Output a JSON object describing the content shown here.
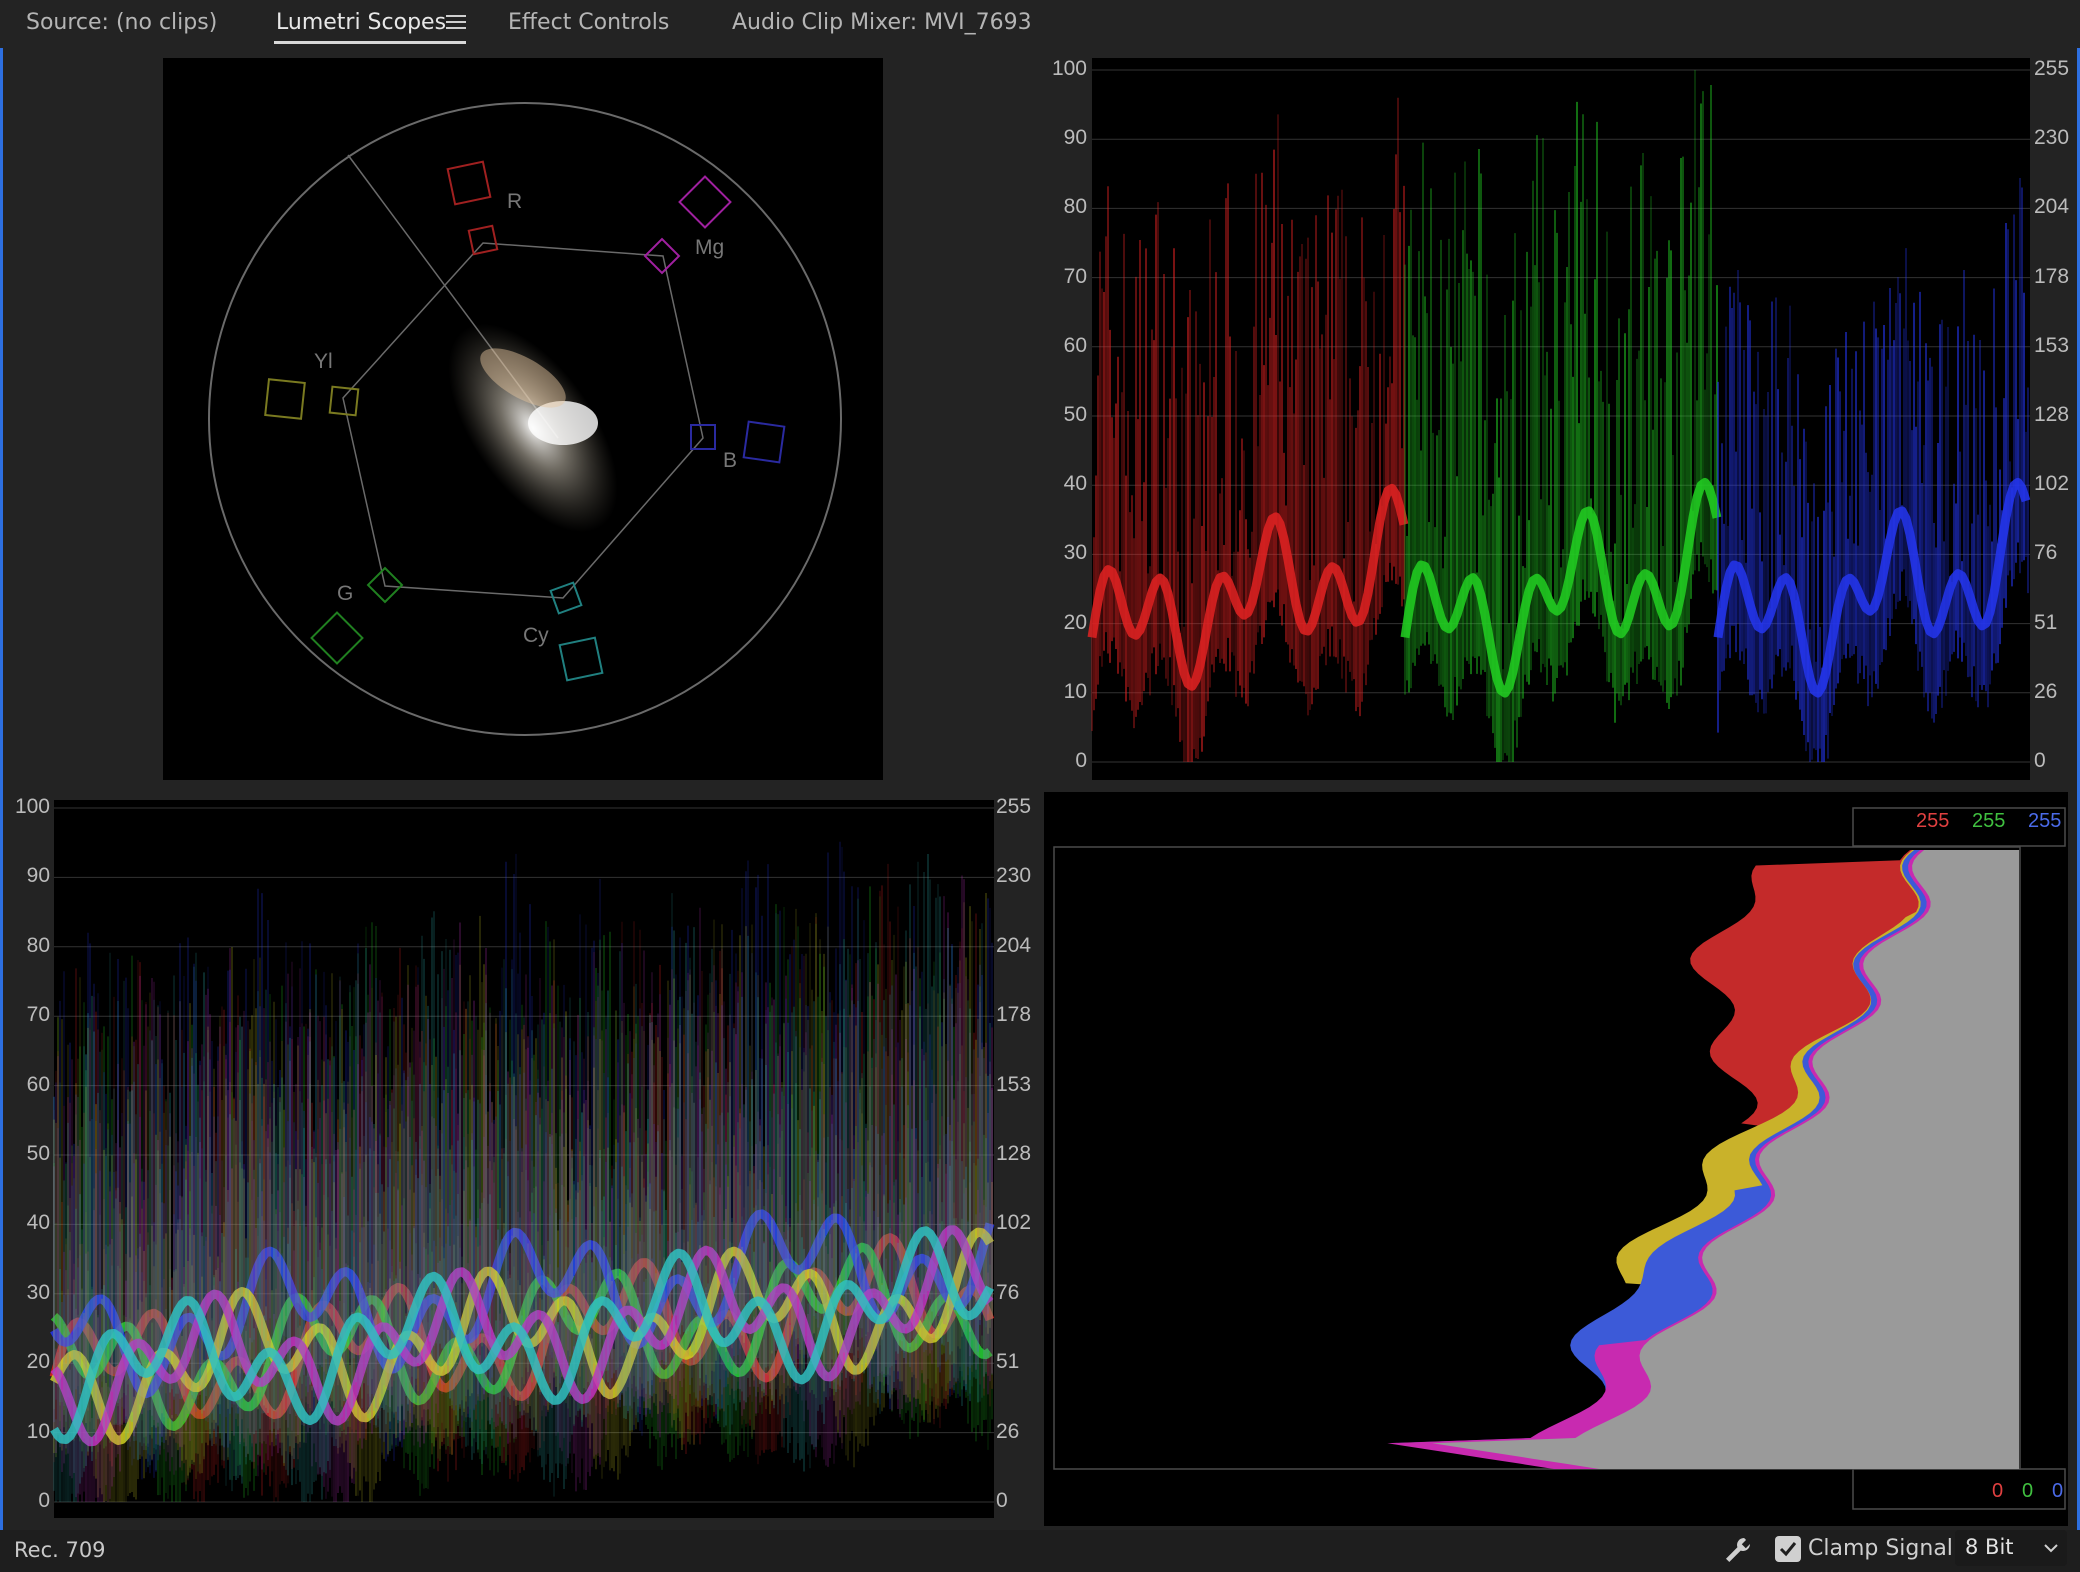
{
  "tabs": [
    {
      "label": "Source: (no clips)",
      "active": false
    },
    {
      "label": "Lumetri Scopes",
      "active": true
    },
    {
      "label": "Effect Controls",
      "active": false
    },
    {
      "label": "Audio Clip Mixer: MVI_7693",
      "active": false
    }
  ],
  "vectorscope": {
    "targets": {
      "red": "R",
      "magenta": "Mg",
      "blue": "B",
      "cyan": "Cy",
      "green": "G",
      "yellow": "Yl"
    }
  },
  "waveform_axis": {
    "ire": [
      "100",
      "90",
      "80",
      "70",
      "60",
      "50",
      "40",
      "30",
      "20",
      "10",
      "0"
    ],
    "code": [
      "255",
      "230",
      "204",
      "178",
      "153",
      "128",
      "102",
      "76",
      "51",
      "26",
      "0"
    ]
  },
  "histogram": {
    "top_values": {
      "red": "255",
      "green": "255",
      "blue": "255"
    },
    "bottom_values": {
      "red": "0",
      "green": "0",
      "blue": "0"
    }
  },
  "statusbar": {
    "color_standard": "Rec. 709",
    "clamp_label": "Clamp Signal",
    "clamp_checked": true,
    "bit_depth": "8 Bit"
  },
  "colors": {
    "accent_border": "#2d6fe0",
    "red": "#e03030",
    "green": "#30c030",
    "blue": "#3050e0"
  },
  "icons": [
    "hamburger-menu-icon",
    "wrench-icon",
    "checkmark-icon",
    "chevron-down-icon"
  ]
}
